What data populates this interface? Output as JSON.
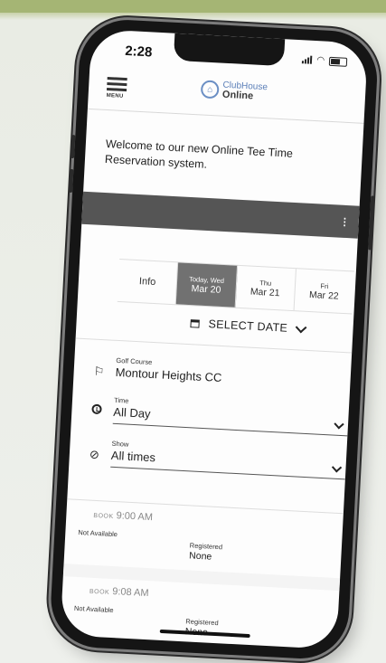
{
  "status": {
    "time": "2:28"
  },
  "header": {
    "menu_label": "MENU",
    "logo_line1": "ClubHouse",
    "logo_line2": "Online"
  },
  "welcome_text": "Welcome to our new Online Tee Time Reservation system.",
  "dark_bar": {
    "dots": "⋮"
  },
  "tabs": [
    {
      "small": "",
      "label": "Info"
    },
    {
      "small": "Today, Wed",
      "label": "Mar 20",
      "active": true
    },
    {
      "small": "Thu",
      "label": "Mar 21"
    },
    {
      "small": "Fri",
      "label": "Mar 22"
    }
  ],
  "select_date_label": "SELECT DATE",
  "fields": {
    "course": {
      "label": "Golf Course",
      "value": "Montour Heights CC",
      "icon": "flag-icon"
    },
    "time": {
      "label": "Time",
      "value": "All Day",
      "icon": "clock-icon"
    },
    "show": {
      "label": "Show",
      "value": "All times",
      "icon": "eye-slash-icon"
    }
  },
  "slots": [
    {
      "book": "BOOK",
      "time": "9:00 AM",
      "status": "Not Available",
      "registered_label": "Registered",
      "registered_value": "None"
    },
    {
      "book": "BOOK",
      "time": "9:08 AM",
      "status": "Not Available",
      "registered_label": "Registered",
      "registered_value": "None"
    }
  ]
}
